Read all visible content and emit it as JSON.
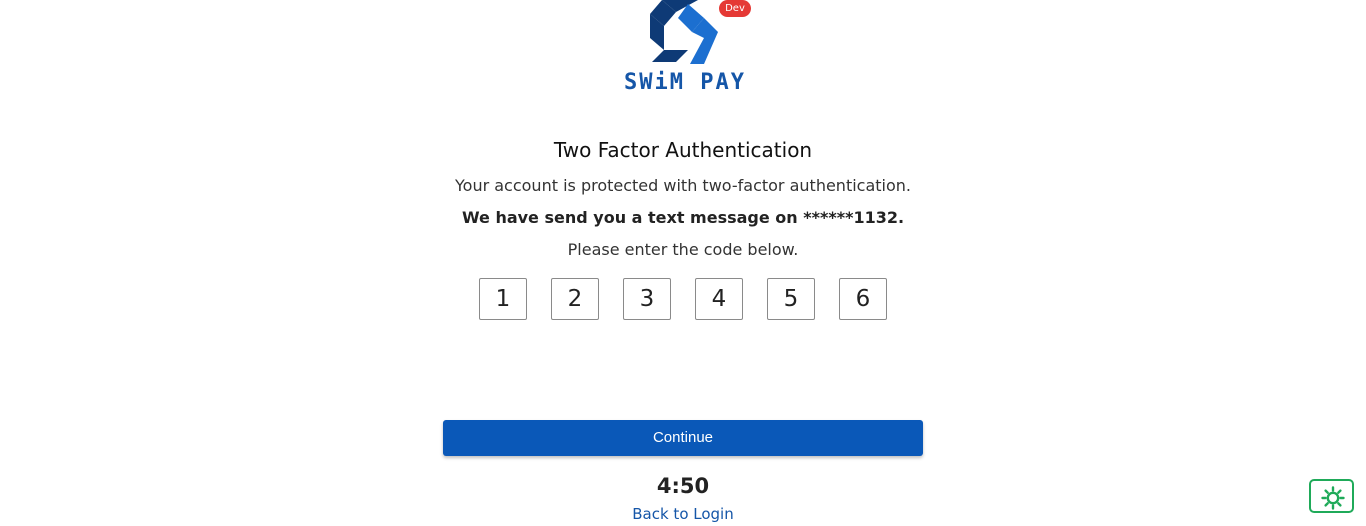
{
  "header": {
    "badge": "Dev",
    "brand": "SWiM PAY"
  },
  "title": "Two Factor Authentication",
  "description": {
    "line1": "Your account is protected with two-factor authentication.",
    "line2": "We have send you a text message on ******1132.",
    "line3": "Please enter the code below."
  },
  "code": [
    "1",
    "2",
    "3",
    "4",
    "5",
    "6"
  ],
  "actions": {
    "continue_label": "Continue",
    "timer": "4:50",
    "back_label": "Back to Login"
  },
  "icons": {
    "logo": "swimpay-logo-icon",
    "settings": "gear-icon"
  },
  "colors": {
    "primary": "#0a58b8",
    "brand": "#1556a8",
    "badge": "#e53935",
    "settings_border": "#1faa59"
  }
}
